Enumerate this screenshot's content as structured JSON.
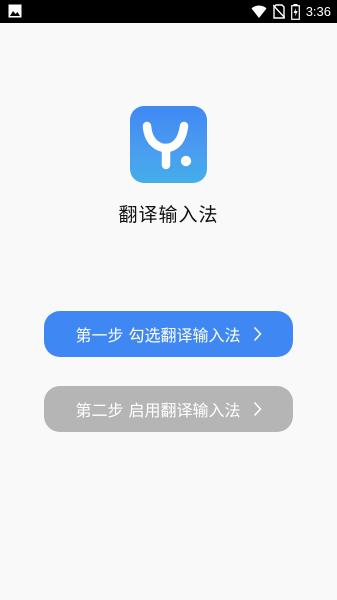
{
  "status_bar": {
    "time": "3:36"
  },
  "app": {
    "name": "翻译输入法",
    "logo_icon": "y-dot-logo-icon",
    "accent_color": "#3f88f3"
  },
  "steps": [
    {
      "label": "第一步 勾选翻译输入法",
      "state": "active",
      "color": "#3f88f3"
    },
    {
      "label": "第二步 启用翻译输入法",
      "state": "disabled",
      "color": "#b5b5b5"
    }
  ]
}
